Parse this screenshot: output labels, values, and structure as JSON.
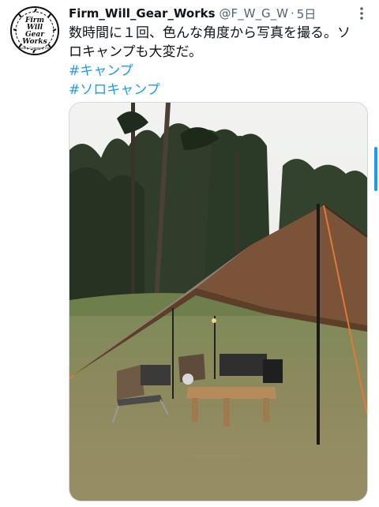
{
  "author": {
    "display_name": "Firm_Will_Gear_Works",
    "handle": "@F_W_G_W",
    "separator": "·",
    "time": "5日",
    "avatar": {
      "logo_lines": [
        "Firm",
        "Will",
        "Gear",
        "Works"
      ],
      "logo_small": "Quality Camping Gear"
    }
  },
  "tweet": {
    "line1": "数時間に１回、色んな角度から写真を撮る。ソ",
    "line2": "ロキャンプも大変だ。",
    "hashtags": [
      "#キャンプ",
      "#ソロキャンプ"
    ]
  },
  "icons": {
    "more": "more-vertical-icon"
  },
  "colors": {
    "link": "#1d9bf0",
    "muted": "#536471",
    "text": "#0f1419"
  }
}
